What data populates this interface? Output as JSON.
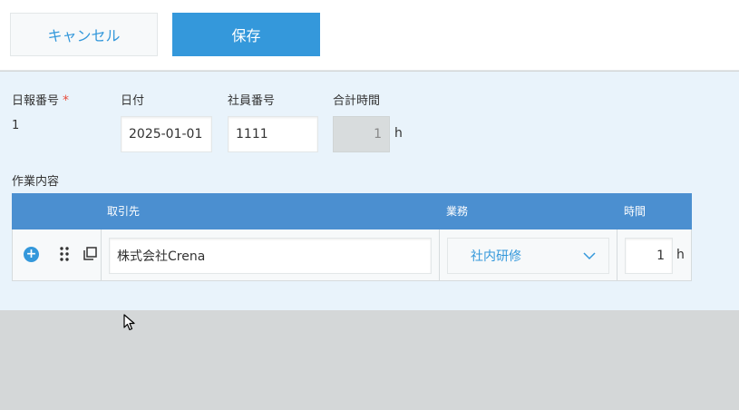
{
  "toolbar": {
    "cancel_label": "キャンセル",
    "save_label": "保存"
  },
  "fields": {
    "report_number": {
      "label": "日報番号",
      "required_mark": "*",
      "value": "1"
    },
    "date": {
      "label": "日付",
      "value": "2025-01-01"
    },
    "employee_number": {
      "label": "社員番号",
      "value": "1111"
    },
    "total_hours": {
      "label": "合計時間",
      "value": "1",
      "unit": "h"
    }
  },
  "work_table": {
    "section_label": "作業内容",
    "columns": [
      "取引先",
      "業務",
      "時間"
    ],
    "rows": [
      {
        "client": "株式会社Crena",
        "task": "社内研修",
        "hours": "1",
        "unit": "h"
      }
    ]
  },
  "icons": {
    "add": "add-row-icon",
    "drag": "drag-handle-icon",
    "copy": "copy-row-icon",
    "chevron": "chevron-down-icon",
    "cursor": "mouse-pointer-icon"
  },
  "colors": {
    "accent": "#3498db",
    "table_header": "#4b8fd0",
    "form_background": "#e9f3fb",
    "required": "#e74c3c"
  }
}
